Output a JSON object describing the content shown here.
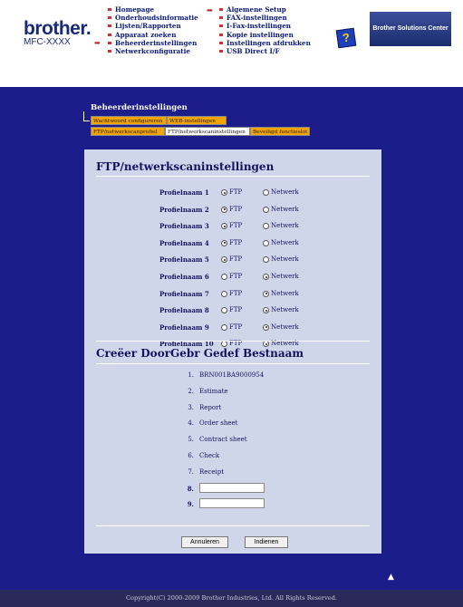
{
  "header": {
    "logo": "brother.",
    "model": "MFC-XXXX",
    "nav_left": [
      "Homepage",
      "Onderhoudsinformatie",
      "Lijsten/Rapporten",
      "Apparaat zoeken",
      "Beheerderinstellingen",
      "Netwerkconfiguratie"
    ],
    "nav_right": [
      "Algemene Setup",
      "FAX-instellingen",
      "I-Fax-instellingen",
      "Kopie instellingen",
      "Instellingen afdrukken",
      "USB Direct I/F"
    ],
    "help_label": "?",
    "solutions_label": "Brother Solutions Center"
  },
  "section_title": "Beheerderinstellingen",
  "tabs": {
    "row1": [
      "Wachtwoord configureren",
      "WEB-instellingen"
    ],
    "row2": [
      "FTP/netwerkscanprofiel",
      "FTP/netwerkscaninstellingen",
      "Beveiligd functieslot"
    ]
  },
  "ftp_section": {
    "title": "FTP/netwerkscaninstellingen",
    "option_ftp": "FTP",
    "option_network": "Netwerk",
    "profiles": [
      {
        "name": "Profielnaam 1",
        "selected": "FTP"
      },
      {
        "name": "Profielnaam 2",
        "selected": "FTP"
      },
      {
        "name": "Profielnaam 3",
        "selected": "FTP"
      },
      {
        "name": "Profielnaam 4",
        "selected": "FTP"
      },
      {
        "name": "Profielnaam 5",
        "selected": "FTP"
      },
      {
        "name": "Profielnaam 6",
        "selected": "Netwerk"
      },
      {
        "name": "Profielnaam 7",
        "selected": "Netwerk"
      },
      {
        "name": "Profielnaam 8",
        "selected": "Netwerk"
      },
      {
        "name": "Profielnaam 9",
        "selected": "Netwerk"
      },
      {
        "name": "Profielnaam 10",
        "selected": "Netwerk"
      }
    ]
  },
  "filename_section": {
    "title": "Creëer DoorGebr Gedef Bestnaam",
    "names": [
      {
        "num": "1.",
        "value": "BRN001BA9000954"
      },
      {
        "num": "2.",
        "value": "Estimate"
      },
      {
        "num": "3.",
        "value": "Report"
      },
      {
        "num": "4.",
        "value": "Order sheet"
      },
      {
        "num": "5.",
        "value": "Contract sheet"
      },
      {
        "num": "6.",
        "value": "Check"
      },
      {
        "num": "7.",
        "value": "Receipt"
      }
    ],
    "inputs": [
      {
        "num": "8.",
        "value": ""
      },
      {
        "num": "9.",
        "value": ""
      }
    ]
  },
  "buttons": {
    "cancel": "Annuleren",
    "submit": "Indienen"
  },
  "top_arrow": "▲",
  "copyright": "Copyright(C) 2000-2009 Brother Industries, Ltd. All Rights Reserved."
}
